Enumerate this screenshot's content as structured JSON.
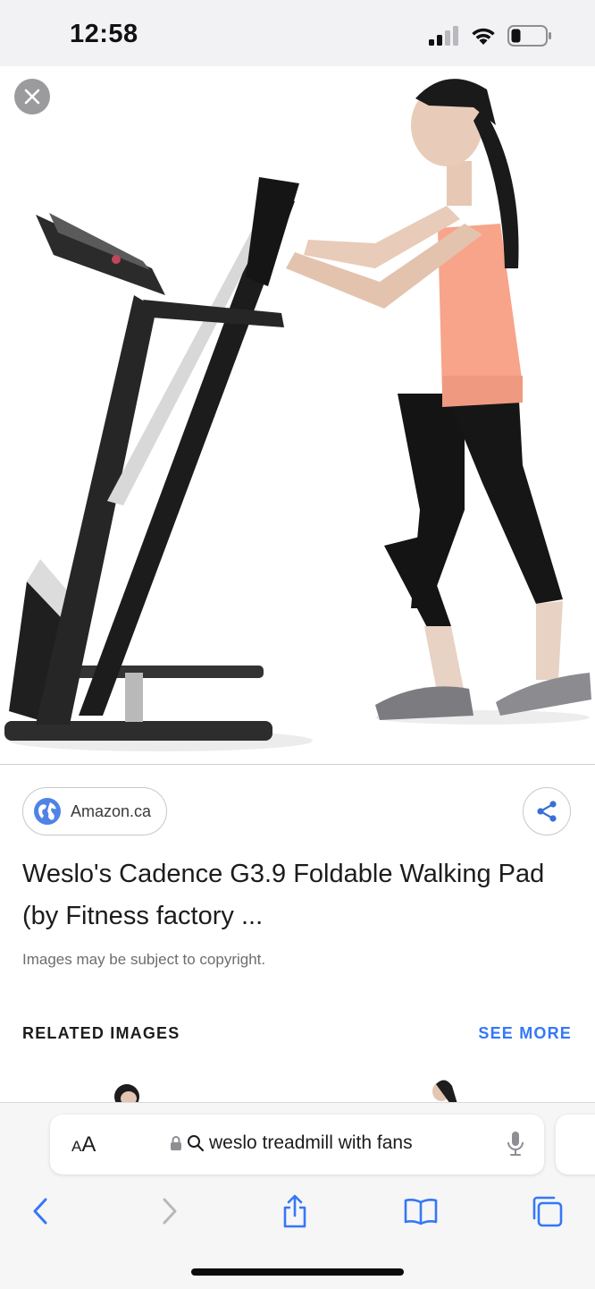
{
  "status_bar": {
    "time": "12:58",
    "icons": [
      "cellular-signal-icon",
      "wifi-icon",
      "battery-icon"
    ]
  },
  "image_viewer": {
    "close_icon": "close-icon",
    "image_alt": "treadmill-with-woman-photo"
  },
  "result": {
    "source_label": "Amazon.ca",
    "source_icon": "globe-icon",
    "share_icon": "share-icon",
    "title": "Weslo's Cadence G3.9 Foldable Walking Pad (by Fitness factory ...",
    "copyright_note": "Images may be subject to copyright."
  },
  "related": {
    "heading": "RELATED IMAGES",
    "see_more": "SEE MORE"
  },
  "address_bar": {
    "aa_small": "A",
    "aa_big": "A",
    "lock_icon": "lock-icon",
    "search_icon": "search-icon",
    "query": "weslo treadmill with fans",
    "mic_icon": "microphone-icon"
  },
  "bottom_nav": {
    "items": [
      "back-icon",
      "forward-icon",
      "share-icon",
      "bookmarks-icon",
      "tabs-icon"
    ]
  },
  "colors": {
    "accent": "#3478f6",
    "status_bar_bg": "#f2f2f4",
    "toolbar_bg": "#f6f6f7"
  }
}
